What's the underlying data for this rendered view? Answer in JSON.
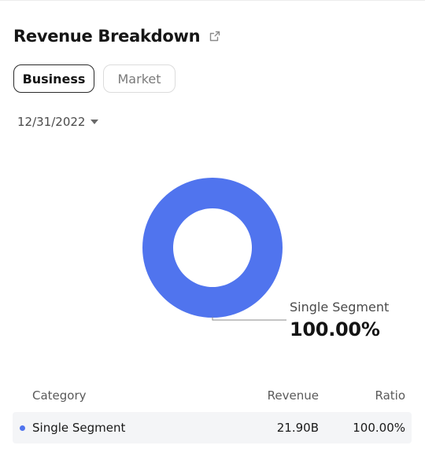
{
  "header": {
    "title": "Revenue Breakdown",
    "share_icon": "share-icon"
  },
  "tabs": [
    {
      "label": "Business",
      "active": true
    },
    {
      "label": "Market",
      "active": false
    }
  ],
  "date_select": {
    "value": "12/31/2022",
    "icon": "caret-down-icon"
  },
  "colors": {
    "segment": "#5074EE",
    "leader_line": "#8a8a8a",
    "row_background": "#F4F5F7"
  },
  "chart_data": {
    "type": "pie",
    "style": "donut",
    "categories": [
      "Single Segment"
    ],
    "values": [
      100.0
    ],
    "labels": [
      "Single Segment"
    ],
    "percent_labels": [
      "100.00%"
    ],
    "unit": "%"
  },
  "table": {
    "headers": {
      "category": "Category",
      "revenue": "Revenue",
      "ratio": "Ratio"
    },
    "rows": [
      {
        "category": "Single Segment",
        "revenue": "21.90B",
        "ratio": "100.00%"
      }
    ]
  }
}
